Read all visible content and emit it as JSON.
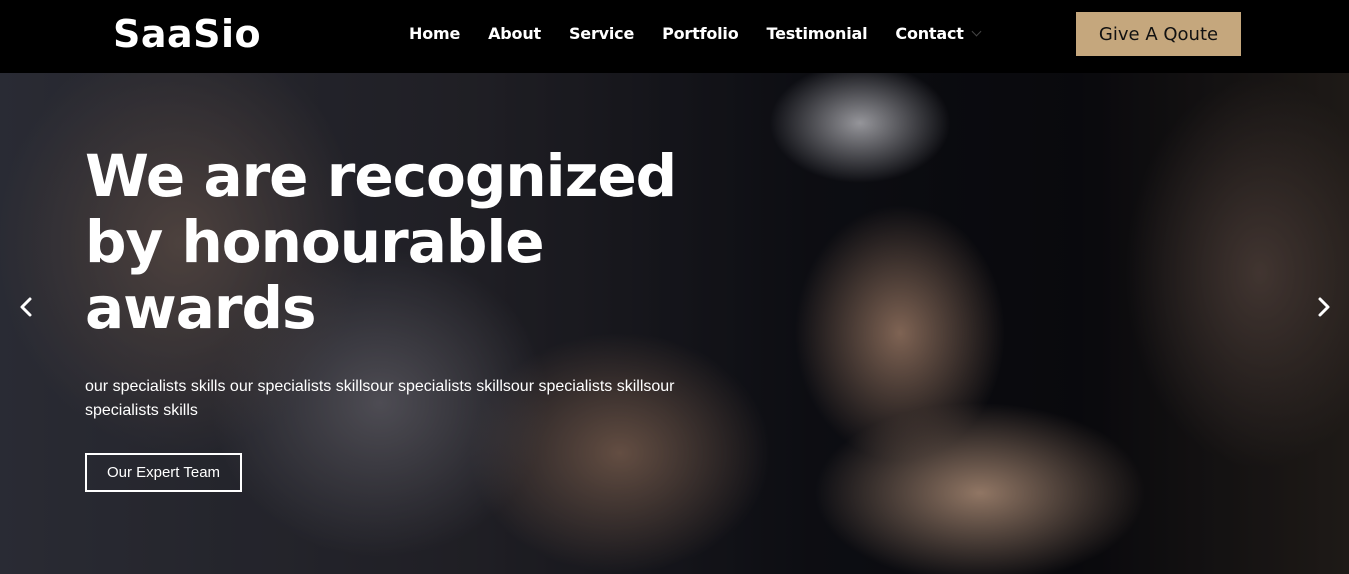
{
  "brand": {
    "logo_text": "SaaSio"
  },
  "nav": {
    "items": [
      {
        "label": "Home"
      },
      {
        "label": "About"
      },
      {
        "label": "Service"
      },
      {
        "label": "Portfolio"
      },
      {
        "label": "Testimonial"
      },
      {
        "label": "Contact"
      }
    ],
    "cta_label": "Give A Qoute"
  },
  "hero": {
    "title": "We are recognized by honourable awards",
    "text": "our specialists skills our specialists skillsour specialists skillsour specialists skillsour specialists skills",
    "button_label": "Our Expert Team",
    "prev_icon": "chevron-left-icon",
    "next_icon": "chevron-right-icon"
  },
  "colors": {
    "header_bg": "#000000",
    "cta_bg": "#c5a77d",
    "text": "#ffffff"
  }
}
